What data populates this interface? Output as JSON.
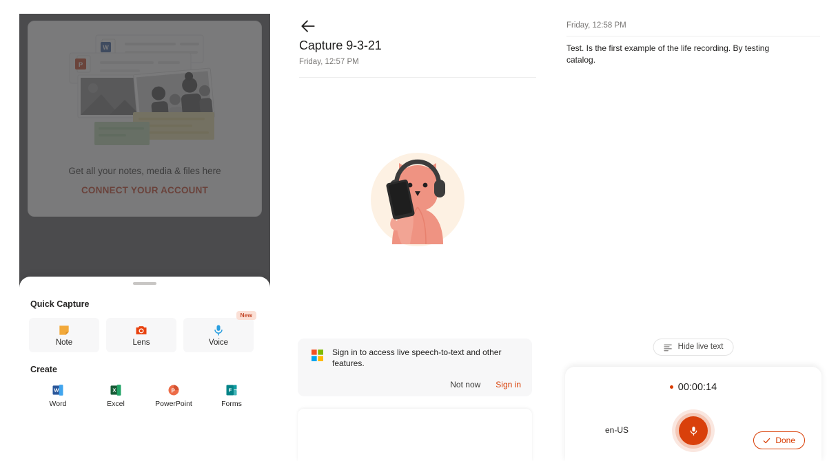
{
  "panel_home": {
    "empty_state": {
      "illustration": "files-media-illustration",
      "message": "Get all your notes, media & files here",
      "connect_label": "CONNECT YOUR ACCOUNT"
    },
    "bottom_sheet": {
      "quick_capture_heading": "Quick Capture",
      "quick_capture_items": [
        {
          "label": "Note",
          "icon": "sticky-note-icon",
          "badge": ""
        },
        {
          "label": "Lens",
          "icon": "camera-icon",
          "badge": ""
        },
        {
          "label": "Voice",
          "icon": "microphone-icon",
          "badge": "New"
        }
      ],
      "create_heading": "Create",
      "create_items": [
        {
          "label": "Word",
          "icon": "word-icon"
        },
        {
          "label": "Excel",
          "icon": "excel-icon"
        },
        {
          "label": "PowerPoint",
          "icon": "powerpoint-icon"
        },
        {
          "label": "Forms",
          "icon": "forms-icon"
        }
      ]
    }
  },
  "panel_capture": {
    "back_icon": "back-arrow-icon",
    "title": "Capture 9-3-21",
    "subtitle": "Friday, 12:57 PM",
    "illustration": "cat-with-headphones-illustration",
    "signin_card": {
      "logo": "microsoft-logo-icon",
      "message": "Sign in to access live speech-to-text and other features.",
      "dismiss_label": "Not now",
      "signin_label": "Sign in"
    }
  },
  "panel_recording": {
    "date": "Friday, 12:58 PM",
    "transcript": "Test. Is the first example of the life recording. By testing catalog.",
    "hide_live_text": {
      "icon": "text-lines-icon",
      "label": "Hide live text"
    },
    "recorder": {
      "timer": "00:00:14",
      "language": "en-US",
      "mic_icon": "microphone-icon",
      "done_icon": "check-icon",
      "done_label": "Done"
    }
  },
  "colors": {
    "accent": "#d83b01",
    "mic_button": "#d9400b",
    "connect_link": "#c4381a",
    "badge_bg": "#fbe0d6",
    "badge_text": "#c4492a",
    "scrim": "#58585a"
  }
}
